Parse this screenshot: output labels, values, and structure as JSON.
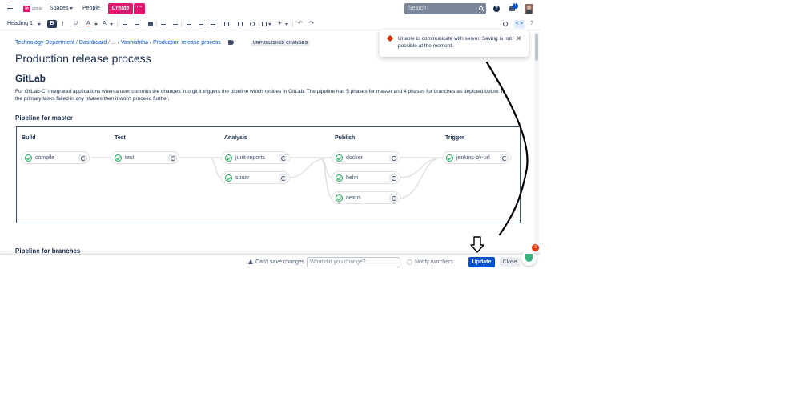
{
  "topnav": {
    "logo_text": "group",
    "spaces": "Spaces",
    "people": "People",
    "create": "Create",
    "more": "···",
    "search_placeholder": "Search",
    "help": "?",
    "notification_count": "1"
  },
  "toolbar": {
    "heading": "Heading 1",
    "bold": "B",
    "italic": "I",
    "underline": "U",
    "text_color": "A",
    "clear_format": "A",
    "code_toggle": "< >",
    "help": "?"
  },
  "breadcrumb": {
    "items": [
      "Technology Department",
      "Dashboard",
      "...",
      "Vashishtha",
      "Production release process"
    ],
    "status": "UNPUBLISHED CHANGES"
  },
  "page": {
    "title": "Production release process",
    "heading": "GitLab",
    "paragraph": "For GitLab-CI integrated applications when a user commits the changes into git it triggers the pipeline which resides in GitLab. The pipeline has 5 phases for master and 4 phases for branches as depicted below. If the primary tasks failed in any phases then it won't proceed further.",
    "master_heading": "Pipeline for master",
    "branches_heading": "Pipeline for branches"
  },
  "pipeline": {
    "stages": [
      {
        "title": "Build",
        "jobs": [
          "compile"
        ]
      },
      {
        "title": "Test",
        "jobs": [
          "test"
        ]
      },
      {
        "title": "Analysis",
        "jobs": [
          "junit-reports",
          "sonar"
        ]
      },
      {
        "title": "Publish",
        "jobs": [
          "docker",
          "helm",
          "nexus"
        ]
      },
      {
        "title": "Trigger",
        "jobs": [
          "jenkins-by-url"
        ]
      }
    ]
  },
  "toast": {
    "message": "Unable to communicate with server. Saving is not possible at the moment.",
    "close": "✕"
  },
  "bottombar": {
    "cant_save": "Can't save changes",
    "change_placeholder": "What did you change?",
    "notify": "Notify watchers",
    "update": "Update",
    "close": "Close",
    "shield_badge": "3"
  },
  "colors": {
    "brand": "#e2186f",
    "primary": "#0052cc",
    "error": "#de350b",
    "success": "#1aaa55"
  }
}
